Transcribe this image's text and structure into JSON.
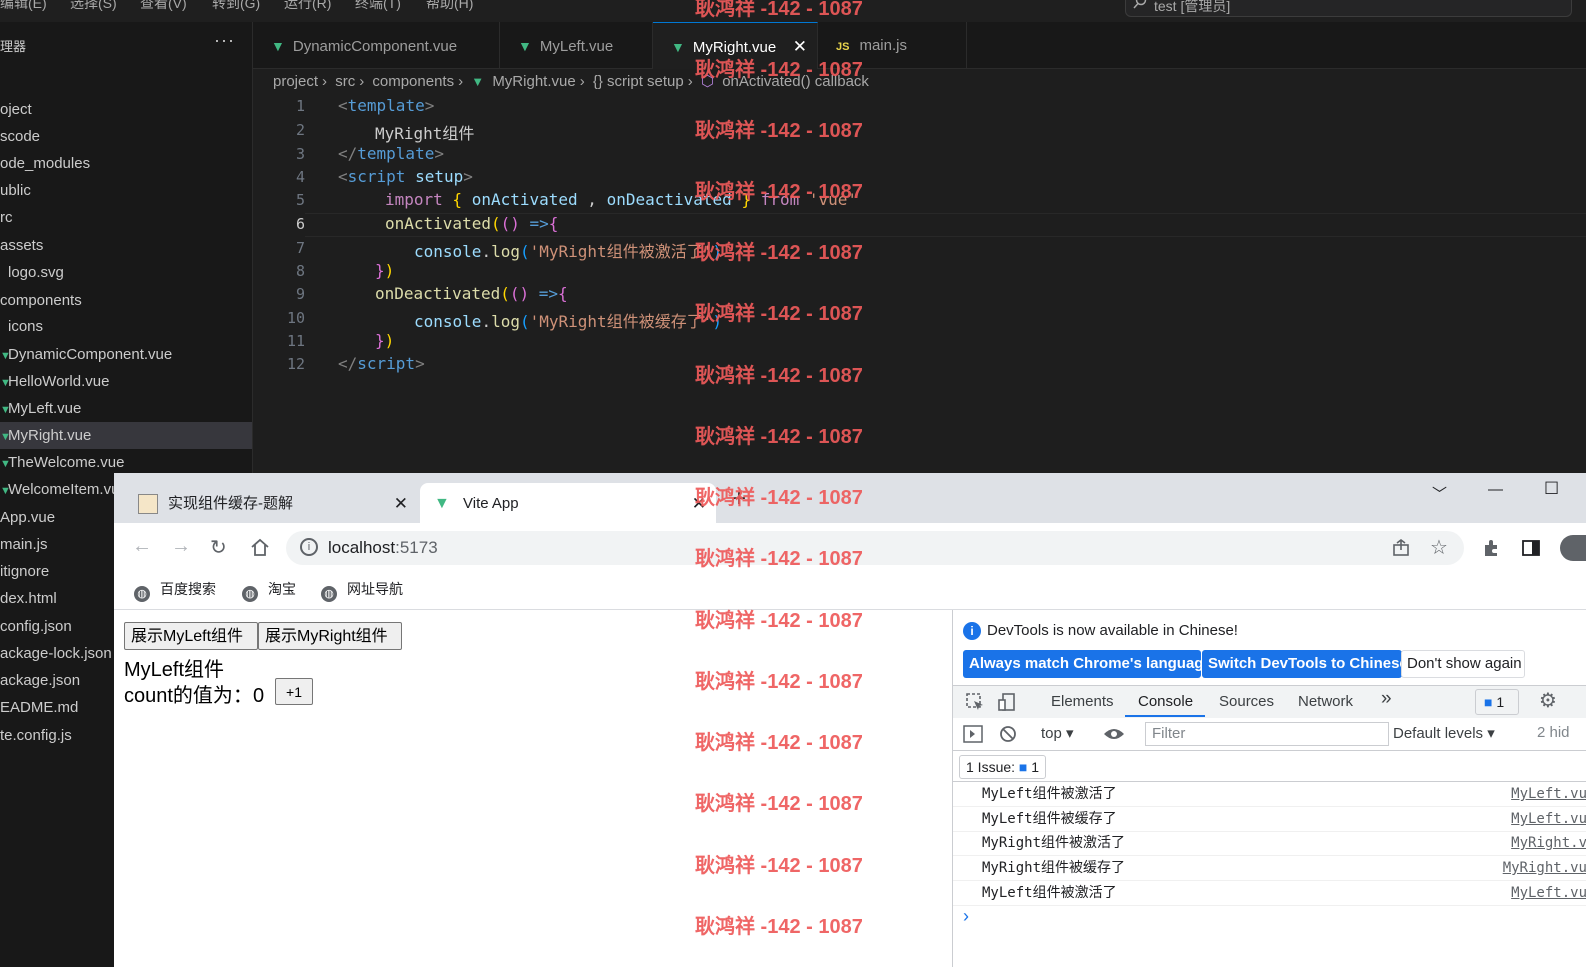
{
  "vscode": {
    "menu": [
      "编辑(E)",
      "选择(S)",
      "查看(V)",
      "转到(G)",
      "运行(R)",
      "终端(T)",
      "帮助(H)"
    ],
    "command_center": "test [管理员]",
    "explorer_title": "理器",
    "explorer_more": "···",
    "tree": [
      "oject",
      "scode",
      "ode_modules",
      "ublic",
      "rc",
      "assets",
      "logo.svg",
      "components",
      "icons",
      "DynamicComponent.vue",
      "HelloWorld.vue",
      "MyLeft.vue",
      "MyRight.vue",
      "TheWelcome.vue",
      "WelcomeItem.vue",
      "App.vue",
      "main.js",
      "itignore",
      "dex.html",
      "config.json",
      "ackage-lock.json",
      "ackage.json",
      "EADME.md",
      "te.config.js"
    ],
    "tabs": [
      {
        "label": "DynamicComponent.vue",
        "icon": "vue-icon"
      },
      {
        "label": "MyLeft.vue",
        "icon": "vue-icon"
      },
      {
        "label": "MyRight.vue",
        "icon": "vue-icon",
        "close": "✕"
      },
      {
        "label": "main.js",
        "icon": "js-icon",
        "icon_text": "JS"
      }
    ],
    "breadcrumb": [
      "project",
      "src",
      "components",
      "MyRight.vue",
      "{} script setup",
      "onActivated() callback"
    ],
    "line_numbers": [
      "1",
      "2",
      "3",
      "4",
      "5",
      "6",
      "7",
      "8",
      "9",
      "10",
      "11",
      "12"
    ],
    "code": {
      "l1_open": "<",
      "l1_tag": "template",
      "l1_close": ">",
      "l2_text": "MyRight组件",
      "l3_open": "</",
      "l3_tag": "template",
      "l3_close": ">",
      "l4_open": "<",
      "l4_tag": "script",
      "l4_attr": " setup",
      "l4_close": ">",
      "l5_import": "import",
      "l5_brace_open": " { ",
      "l5_a": "onActivated",
      "l5_comma": " , ",
      "l5_b": "onDeactivated",
      "l5_brace_close": " } ",
      "l5_from": "from",
      "l5_src": " 'vue'",
      "l6_fn": "onActivated",
      "l6_p1": "(",
      "l6_p2": "()",
      "l6_arrow": " =>",
      "l6_brace": "{",
      "l7_obj": "console",
      "l7_dot": ".",
      "l7_fn": "log",
      "l7_p": "(",
      "l7_str": "'MyRight组件被激活了'",
      "l7_pc": ")",
      "l8_brace": "}",
      "l8_p": ")",
      "l9_fn": "onDeactivated",
      "l9_p1": "(",
      "l9_p2": "()",
      "l9_arrow": " =>",
      "l9_brace": "{",
      "l10_obj": "console",
      "l10_dot": ".",
      "l10_fn": "log",
      "l10_p": "(",
      "l10_str": "'MyRight组件被缓存了'",
      "l10_pc": ")",
      "l11_brace": "}",
      "l11_p": ")",
      "l12_open": "</",
      "l12_tag": "script",
      "l12_close": ">"
    }
  },
  "browser": {
    "tabs": [
      {
        "label": "实现组件缓存-题解",
        "close": "✕"
      },
      {
        "label": "Vite App",
        "close": "✕"
      }
    ],
    "new_tab": "+",
    "window_controls": [
      "﹀",
      "—",
      "☐"
    ],
    "url_host": "localhost",
    "url_port": ":5173",
    "bookmarks": [
      "百度搜索",
      "淘宝",
      "网址导航"
    ],
    "page": {
      "btn_left": "展示MyLeft组件",
      "btn_right": "展示MyRight组件",
      "component_title": "MyLeft组件",
      "count_label": "count的值为：",
      "count_value": "0",
      "inc_btn": "+1"
    }
  },
  "devtools": {
    "banner": "DevTools is now available in Chinese!",
    "btn_match": "Always match Chrome's language",
    "btn_switch": "Switch DevTools to Chinese",
    "btn_dismiss": "Don't show again",
    "tabs": [
      "Elements",
      "Console",
      "Sources",
      "Network"
    ],
    "more_tabs": "»",
    "issue_badge_count": "1",
    "context": "top",
    "filter_placeholder": "Filter",
    "levels": "Default levels",
    "hidden": "2 hid",
    "issues_label": "1 Issue:",
    "issues_count": "1",
    "logs": [
      {
        "msg": "MyLeft组件被激活了",
        "src": "MyLeft.vu"
      },
      {
        "msg": "MyLeft组件被缓存了",
        "src": "MyLeft.vu"
      },
      {
        "msg": "MyRight组件被激活了",
        "src": "MyRight.v"
      },
      {
        "msg": "MyRight组件被缓存了",
        "src": "MyRight.vu"
      },
      {
        "msg": "MyLeft组件被激活了",
        "src": "MyLeft.vu"
      }
    ],
    "prompt": "›"
  },
  "watermark": "耿鸿祥 -142 - 1087",
  "colors": {
    "vscode_bg": "#1e1e1e",
    "vue_green": "#41b883",
    "chrome_blue": "#1a73e8",
    "watermark_red": "#ee5a5a"
  }
}
